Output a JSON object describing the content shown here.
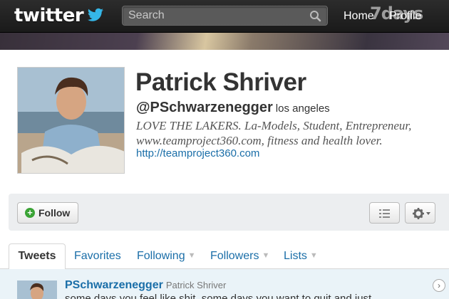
{
  "topbar": {
    "logo": "twitter",
    "search_placeholder": "Search",
    "nav_home": "Home",
    "nav_profile": "Profile",
    "watermark": "7days",
    "icons": [
      "bird-icon",
      "search-icon"
    ]
  },
  "profile": {
    "name": "Patrick Shriver",
    "handle": "@PSchwarzenegger",
    "location": "los angeles",
    "bio": "LOVE THE LAKERS. La-Models, Student, Entrepreneur, www.teamproject360.com, fitness and health lover.",
    "url": "http://teamproject360.com"
  },
  "actions": {
    "follow_label": "Follow",
    "icons": [
      "plus-icon",
      "list-icon",
      "gear-icon",
      "chevron-down-icon"
    ]
  },
  "tabs": [
    {
      "label": "Tweets",
      "active": true
    },
    {
      "label": "Favorites"
    },
    {
      "label": "Following",
      "dropdown": true
    },
    {
      "label": "Followers",
      "dropdown": true
    },
    {
      "label": "Lists",
      "dropdown": true
    }
  ],
  "tweet": {
    "user": "PSchwarzenegger",
    "name": "Patrick Shriver",
    "text": "some days you feel like shit, some days you want to quit and just"
  },
  "colors": {
    "link": "#1a6ea8",
    "topbar": "#1f1f1f",
    "follow_green": "#3aa335",
    "tweet_highlight": "#eaf3f8"
  }
}
